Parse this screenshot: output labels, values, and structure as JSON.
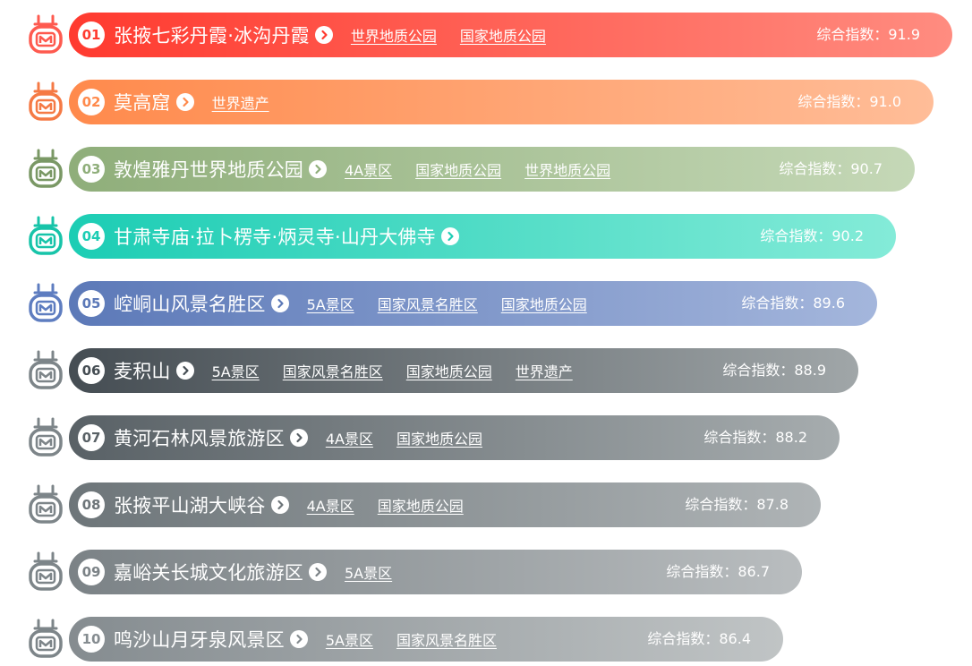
{
  "score_label": "综合指数",
  "score_separator": "：",
  "rows": [
    {
      "rank": "01",
      "name": "张掖七彩丹霞·冰沟丹霞",
      "tags": [
        "世界地质公园",
        "国家地质公园"
      ],
      "score": "91.9",
      "color_start": "#ff3a2f",
      "color_end": "#ff8c80",
      "rank_color": "#fe5a4f"
    },
    {
      "rank": "02",
      "name": "莫高窟",
      "tags": [
        "世界遗产"
      ],
      "score": "91.0",
      "color_start": "#ff8a4c",
      "color_end": "#ffbd98",
      "rank_color": "#f57a45"
    },
    {
      "rank": "03",
      "name": "敦煌雅丹世界地质公园",
      "tags": [
        "4A景区",
        "国家地质公园",
        "世界地质公园"
      ],
      "score": "90.7",
      "color_start": "#8fae7a",
      "color_end": "#c5d8b7",
      "rank_color": "#7a9865"
    },
    {
      "rank": "04",
      "name": "甘肃寺庙·拉卜楞寺·炳灵寺·山丹大佛寺",
      "tags": [],
      "score": "90.2",
      "color_start": "#1ccdb4",
      "color_end": "#84ebd8",
      "rank_color": "#17c4a9"
    },
    {
      "rank": "05",
      "name": "崆峒山风景名胜区",
      "tags": [
        "5A景区",
        "国家风景名胜区",
        "国家地质公园"
      ],
      "score": "89.6",
      "color_start": "#5c79b8",
      "color_end": "#a4b6dc",
      "rank_color": "#5e7dc0"
    },
    {
      "rank": "06",
      "name": "麦积山",
      "tags": [
        "5A景区",
        "国家风景名胜区",
        "国家地质公园",
        "世界遗产"
      ],
      "score": "88.9",
      "color_start": "#454d53",
      "color_end": "#a0a6a8",
      "rank_color": "#7d8589"
    },
    {
      "rank": "07",
      "name": "黄河石林风景旅游区",
      "tags": [
        "4A景区",
        "国家地质公园"
      ],
      "score": "88.2",
      "color_start": "#596166",
      "color_end": "#a6acae",
      "rank_color": "#7d8589"
    },
    {
      "rank": "08",
      "name": "张掖平山湖大峡谷",
      "tags": [
        "4A景区",
        "国家地质公园"
      ],
      "score": "87.8",
      "color_start": "#6d7579",
      "color_end": "#afb4b6",
      "rank_color": "#7d8589"
    },
    {
      "rank": "09",
      "name": "嘉峪关长城文化旅游区",
      "tags": [
        "5A景区"
      ],
      "score": "86.7",
      "color_start": "#7b8286",
      "color_end": "#b9bdbf",
      "rank_color": "#7d8589"
    },
    {
      "rank": "10",
      "name": "鸣沙山月牙泉风景区",
      "tags": [
        "5A景区",
        "国家风景名胜区"
      ],
      "score": "86.4",
      "color_start": "#858c90",
      "color_end": "#c0c4c5",
      "rank_color": "#7d8589"
    }
  ]
}
